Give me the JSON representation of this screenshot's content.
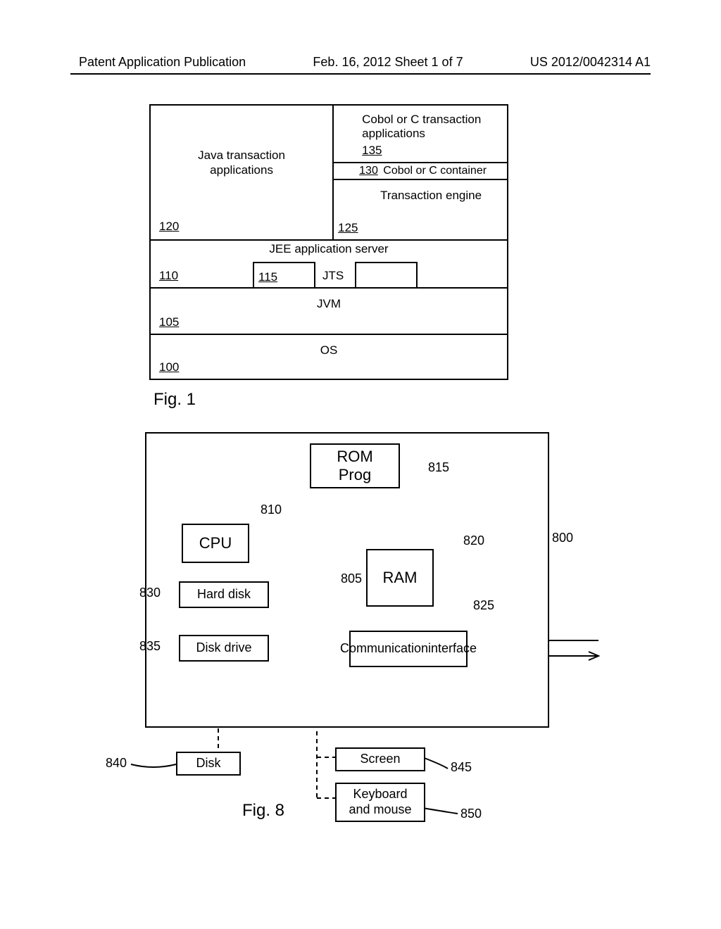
{
  "header": {
    "left": "Patent Application Publication",
    "center": "Feb. 16, 2012  Sheet 1 of 7",
    "right": "US 2012/0042314 A1"
  },
  "fig1": {
    "caption": "Fig. 1",
    "java_title_l1": "Java transaction",
    "java_title_l2": "applications",
    "num_120": "120",
    "cobol_app_l1": "Cobol or C transaction",
    "cobol_app_l2": "applications",
    "num_135": "135",
    "num_130": "130",
    "cobol_container": "Cobol or C container",
    "engine": "Transaction engine",
    "num_125": "125",
    "jee": "JEE application server",
    "num_110": "110",
    "num_115": "115",
    "jts": "JTS",
    "jvm": "JVM",
    "num_105": "105",
    "os": "OS",
    "num_100": "100"
  },
  "fig8": {
    "caption": "Fig. 8",
    "rom_l1": "ROM",
    "rom_l2": "Prog",
    "cpu": "CPU",
    "ram": "RAM",
    "harddisk": "Hard disk",
    "diskdrive": "Disk drive",
    "comm_l1": "Communication",
    "comm_l2": "interface",
    "disk": "Disk",
    "screen": "Screen",
    "keyboard_l1": "Keyboard",
    "keyboard_l2": "and mouse",
    "n800": "800",
    "n805": "805",
    "n810": "810",
    "n815": "815",
    "n820": "820",
    "n825": "825",
    "n830": "830",
    "n835": "835",
    "n840": "840",
    "n845": "845",
    "n850": "850"
  }
}
